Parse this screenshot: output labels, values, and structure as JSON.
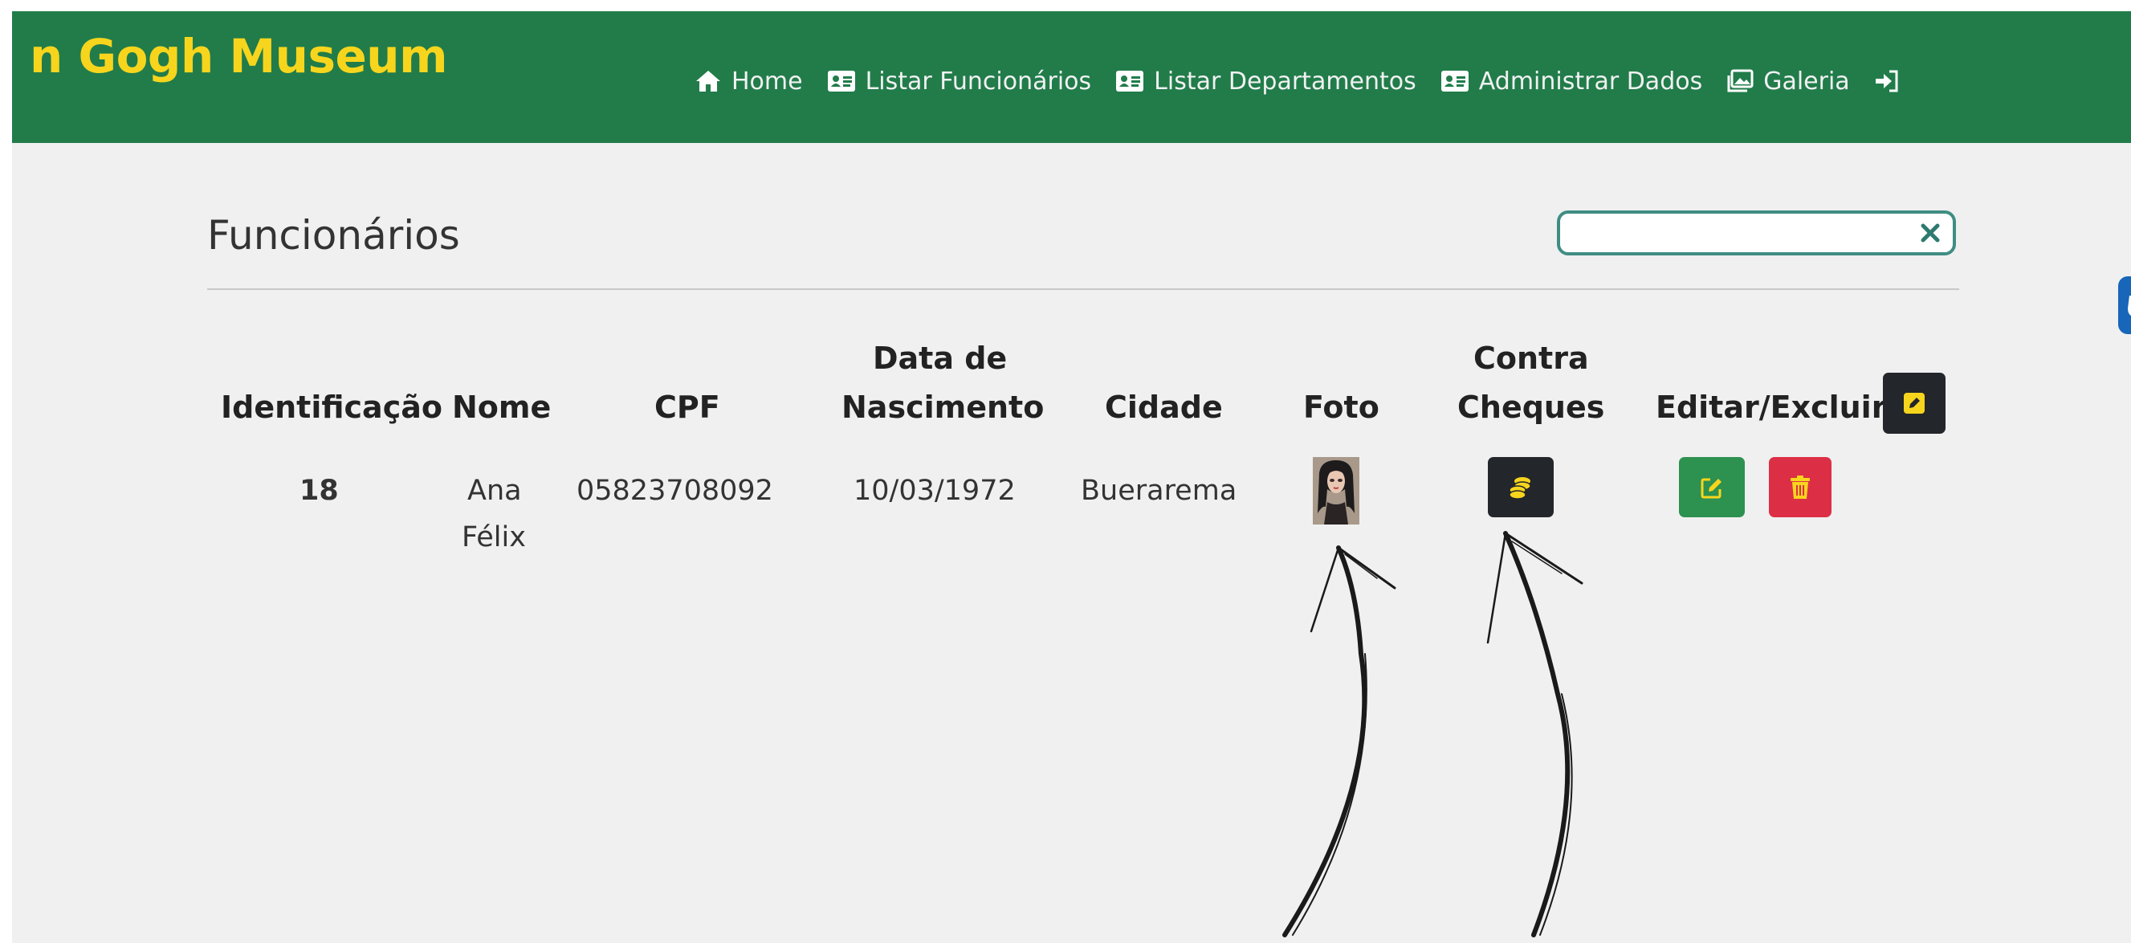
{
  "brand": {
    "name": "n Gogh Museum",
    "color": "#f7d51d"
  },
  "colors": {
    "navbar": "#217c4a",
    "edit": "#2d9150",
    "delete": "#dc2f45",
    "dark_button": "#23262a",
    "search_border": "#3f8d83"
  },
  "nav": {
    "items": [
      {
        "label": "Home",
        "icon": "house-icon"
      },
      {
        "label": "Listar Funcionários",
        "icon": "id-card-icon"
      },
      {
        "label": "Listar Departamentos",
        "icon": "id-card-icon"
      },
      {
        "label": "Administrar Dados",
        "icon": "id-card-icon"
      },
      {
        "label": "Galeria",
        "icon": "images-icon"
      }
    ],
    "login_icon": "sign-in-icon"
  },
  "page": {
    "title": "Funcionários"
  },
  "search": {
    "value": "",
    "placeholder": "",
    "clear_icon": "x-icon"
  },
  "table": {
    "headers": {
      "identificacao": "Identificação",
      "nome": "Nome",
      "cpf": "CPF",
      "data_nasc_1": "Data de",
      "data_nasc_2": "Nascimento",
      "cidade": "Cidade",
      "foto": "Foto",
      "contra_1": "Contra",
      "contra_2": "Cheques",
      "editar": "Editar/Excluir"
    },
    "rows": [
      {
        "id": "18",
        "nome_1": "Ana",
        "nome_2": "Félix",
        "cpf": "05823708092",
        "data_nascimento": "10/03/1972",
        "cidade": "Buerarema"
      }
    ]
  }
}
